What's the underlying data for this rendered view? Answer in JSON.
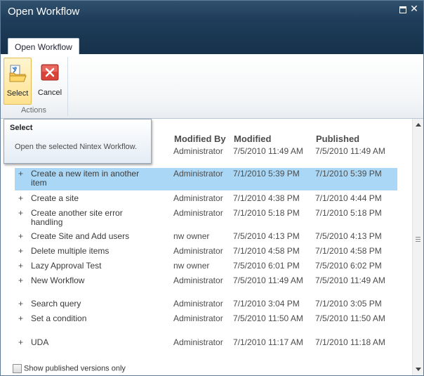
{
  "window": {
    "title": "Open Workflow"
  },
  "tab": {
    "label": "Open Workflow"
  },
  "ribbon": {
    "select_label": "Select",
    "cancel_label": "Cancel",
    "group_label": "Actions"
  },
  "tooltip": {
    "title": "Select",
    "body": "Open the selected Nintex Workflow."
  },
  "table": {
    "columns": [
      "Modified By",
      "Modified",
      "Published"
    ],
    "rows": [
      {
        "expander": "",
        "name": "",
        "modified_by": "Administrator",
        "modified": "7/5/2010 11:49 AM",
        "published": "7/5/2010 11:49 AM"
      },
      {
        "expander": "+",
        "name": "Create a new item in another item",
        "modified_by": "Administrator",
        "modified": "7/1/2010 5:39 PM",
        "published": "7/1/2010 5:39 PM",
        "selected": true
      },
      {
        "expander": "+",
        "name": "Create a site",
        "modified_by": "Administrator",
        "modified": "7/1/2010 4:38 PM",
        "published": "7/1/2010 4:44 PM"
      },
      {
        "expander": "+",
        "name": "Create another site error handling",
        "modified_by": "Administrator",
        "modified": "7/1/2010 5:18 PM",
        "published": "7/1/2010 5:18 PM"
      },
      {
        "expander": "+",
        "name": "Create Site and Add users",
        "modified_by": "nw owner",
        "modified": "7/5/2010 4:13 PM",
        "published": "7/5/2010 4:13 PM"
      },
      {
        "expander": "+",
        "name": "Delete multiple items",
        "modified_by": "Administrator",
        "modified": "7/1/2010 4:58 PM",
        "published": "7/1/2010 4:58 PM"
      },
      {
        "expander": "+",
        "name": "Lazy Approval Test",
        "modified_by": "nw owner",
        "modified": "7/5/2010 6:01 PM",
        "published": "7/5/2010 6:02 PM"
      },
      {
        "expander": "+",
        "name": "New Workflow",
        "modified_by": "Administrator",
        "modified": "7/5/2010 11:49 AM",
        "published": "7/5/2010 11:49 AM"
      },
      {
        "expander": "+",
        "name": "Search query",
        "modified_by": "Administrator",
        "modified": "7/1/2010 3:04 PM",
        "published": "7/1/2010 3:05 PM"
      },
      {
        "expander": "+",
        "name": "Set a condition",
        "modified_by": "Administrator",
        "modified": "7/5/2010 11:50 AM",
        "published": "7/5/2010 11:50 AM"
      },
      {
        "expander": "+",
        "name": "UDA",
        "modified_by": "Administrator",
        "modified": "7/1/2010 11:17 AM",
        "published": "7/1/2010 11:18 AM"
      }
    ]
  },
  "footer": {
    "checkbox_label": "Show published versions only",
    "checked": false
  },
  "colors": {
    "title_bar": "#1f3d5a",
    "selected_row": "#a9d7f5",
    "ribbon_selected": "#ffe28f"
  }
}
